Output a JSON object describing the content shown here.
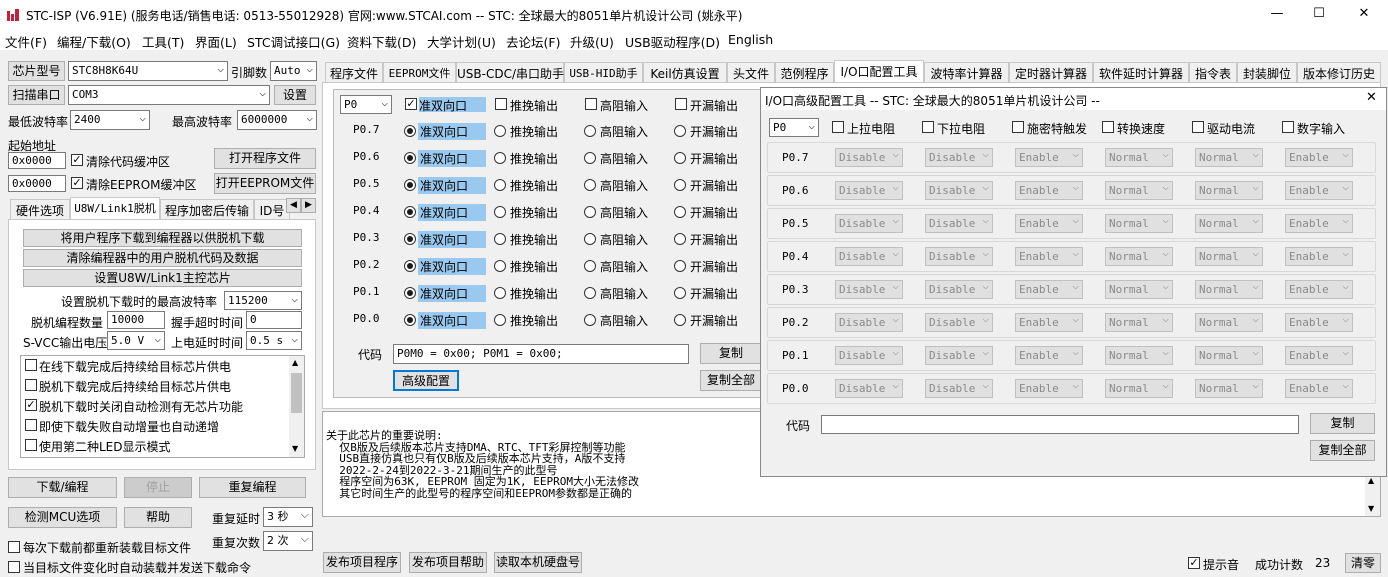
{
  "window": {
    "title": "STC-ISP (V6.91E) (服务电话/销售电话: 0513-55012928) 官网:www.STCAI.com  -- STC: 全球最大的8051单片机设计公司 (姚永平)",
    "minimize": "—",
    "maximize": "☐",
    "close": "✕"
  },
  "menu": [
    "文件(F)",
    "编程/下载(O)",
    "工具(T)",
    "界面(L)",
    "STC调试接口(G)",
    "资料下载(D)",
    "大学计划(U)",
    "去论坛(F)",
    "升级(U)",
    "USB驱动程序(D)",
    "English"
  ],
  "left": {
    "chip_label": "芯片型号",
    "chip_value": "STC8H8K64U",
    "ref_label": "引脚数",
    "ref_value": "Auto",
    "scan_button": "扫描串口",
    "port_value": "COM3",
    "settings_button": "设置",
    "min_baud_label": "最低波特率",
    "min_baud_value": "2400",
    "max_baud_label": "最高波特率",
    "max_baud_value": "6000000",
    "start_addr_label": "起始地址",
    "addr1": "0x0000",
    "clear_code_label": "清除代码缓冲区",
    "open_prog_button": "打开程序文件",
    "addr2": "0x0000",
    "clear_eeprom_label": "清除EEPROM缓冲区",
    "open_eeprom_button": "打开EEPROM文件",
    "tabs": [
      "硬件选项",
      "U8W/Link1脱机",
      "程序加密后传输",
      "ID号"
    ],
    "btn_download_offline": "将用户程序下载到编程器以供脱机下载",
    "btn_clear_offline": "清除编程器中的用户脱机代码及数据",
    "btn_set_master": "设置U8W/Link1主控芯片",
    "max_baud_offline_label": "设置脱机下载时的最高波特率",
    "max_baud_offline_value": "115200",
    "offline_count_label": "脱机编程数量",
    "offline_count_value": "10000",
    "handshake_label": "握手超时时间",
    "handshake_value": "0",
    "svcc_label": "S-VCC输出电压",
    "svcc_value": "5.0 V",
    "power_delay_label": "上电延时时间",
    "power_delay_value": "0.5 s",
    "options": [
      {
        "label": "在线下载完成后持续给目标芯片供电",
        "checked": false
      },
      {
        "label": "脱机下载完成后持续给目标芯片供电",
        "checked": false
      },
      {
        "label": "脱机下载时关闭自动检测有无芯片功能",
        "checked": true
      },
      {
        "label": "即使下载失败自动增量也自动递增",
        "checked": false
      },
      {
        "label": "使用第二种LED显示模式",
        "checked": false
      }
    ],
    "download_button": "下载/编程",
    "stop_button": "停止",
    "reprogram_button": "重复编程",
    "detect_button": "检测MCU选项",
    "help_button": "帮助",
    "repeat_delay_label": "重复延时",
    "repeat_delay_value": "3 秒",
    "repeat_count_label": "重复次数",
    "repeat_count_value": "2 次",
    "reload_each_label": "每次下载前都重新装载目标文件",
    "auto_send_label": "当目标文件变化时自动装载并发送下载命令"
  },
  "top_tabs": [
    "程序文件",
    "EEPROM文件",
    "USB-CDC/串口助手",
    "USB-HID助手",
    "Keil仿真设置",
    "头文件",
    "范例程序",
    "I/O口配置工具",
    "波特率计算器",
    "定时器计算器",
    "软件延时计算器",
    "指令表",
    "封装脚位",
    "版本修订历史"
  ],
  "io": {
    "port_value": "P0",
    "header_options": [
      "准双向口",
      "推挽输出",
      "高阻输入",
      "开漏输出"
    ],
    "pins": [
      "P0.7",
      "P0.6",
      "P0.5",
      "P0.4",
      "P0.3",
      "P0.2",
      "P0.1",
      "P0.0"
    ],
    "code_label": "代码",
    "code_value": "P0M0 = 0x00;  P0M1 = 0x00;",
    "copy_button": "复制",
    "advanced_button": "高级配置",
    "copy_all_button": "复制全部"
  },
  "dialog": {
    "title": "I/O口高级配置工具 -- STC: 全球最大的8051单片机设计公司 --",
    "close": "✕",
    "port_value": "P0",
    "columns": [
      "上拉电阻",
      "下拉电阻",
      "施密特触发",
      "转换速度",
      "驱动电流",
      "数字输入"
    ],
    "rows": [
      {
        "pin": "P0.7",
        "values": [
          "Disable",
          "Disable",
          "Enable",
          "Normal",
          "Normal",
          "Enable"
        ]
      },
      {
        "pin": "P0.6",
        "values": [
          "Disable",
          "Disable",
          "Enable",
          "Normal",
          "Normal",
          "Enable"
        ]
      },
      {
        "pin": "P0.5",
        "values": [
          "Disable",
          "Disable",
          "Enable",
          "Normal",
          "Normal",
          "Enable"
        ]
      },
      {
        "pin": "P0.4",
        "values": [
          "Disable",
          "Disable",
          "Enable",
          "Normal",
          "Normal",
          "Enable"
        ]
      },
      {
        "pin": "P0.3",
        "values": [
          "Disable",
          "Disable",
          "Enable",
          "Normal",
          "Normal",
          "Enable"
        ]
      },
      {
        "pin": "P0.2",
        "values": [
          "Disable",
          "Disable",
          "Enable",
          "Normal",
          "Normal",
          "Enable"
        ]
      },
      {
        "pin": "P0.1",
        "values": [
          "Disable",
          "Disable",
          "Enable",
          "Normal",
          "Normal",
          "Enable"
        ]
      },
      {
        "pin": "P0.0",
        "values": [
          "Disable",
          "Disable",
          "Enable",
          "Normal",
          "Normal",
          "Enable"
        ]
      }
    ],
    "code_label": "代码",
    "copy_button": "复制",
    "copy_all_button": "复制全部"
  },
  "info_lines": [
    "关于此芯片的重要说明:",
    "  仅B版及后续版本芯片支持DMA、RTC、TFT彩屏控制等功能",
    "  USB直接仿真也只有仅B版及后续版本芯片支持，A版不支持",
    "",
    "  2022-2-24到2022-3-21期间生产的此型号",
    "  程序空间为63K, EEPROM 固定为1K, EEPROM大小无法修改",
    "  其它时间生产的此型号的程序空间和EEPROM参数都是正确的"
  ],
  "bottom": {
    "publish_button": "发布项目程序",
    "publish_help_button": "发布项目帮助",
    "read_disk_button": "读取本机硬盘号",
    "sound_label": "提示音",
    "success_label": "成功计数",
    "success_value": "23",
    "clear_button": "清零"
  }
}
